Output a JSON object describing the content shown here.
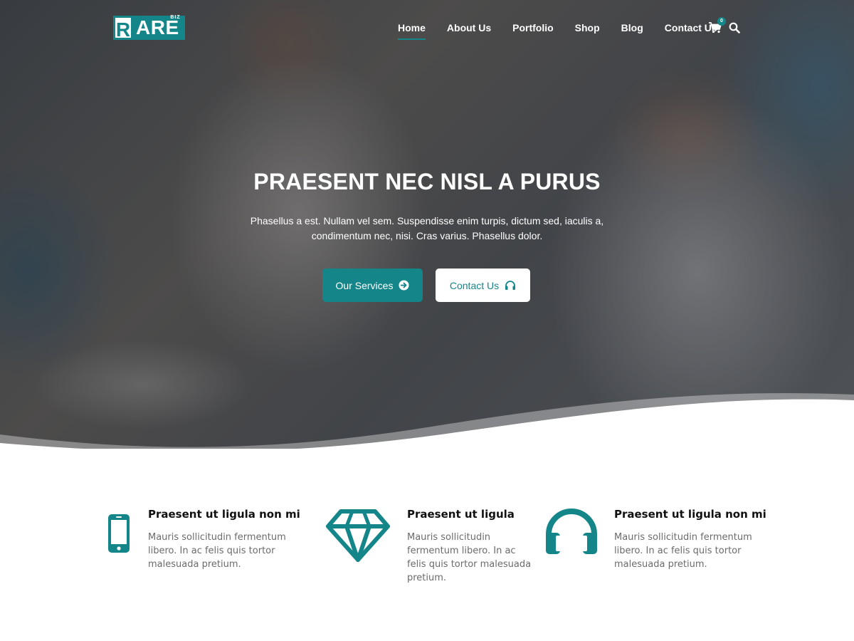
{
  "brand": {
    "logo_letter": "R",
    "logo_text": "ARE",
    "logo_tag": "BIZ",
    "accent": "#14868a"
  },
  "nav": {
    "items": [
      {
        "label": "Home",
        "active": true
      },
      {
        "label": "About Us",
        "active": false
      },
      {
        "label": "Portfolio",
        "active": false
      },
      {
        "label": "Shop",
        "active": false
      },
      {
        "label": "Blog",
        "active": false
      },
      {
        "label": "Contact Us",
        "active": false
      }
    ],
    "cart_icon": "shopping-cart-icon",
    "cart_count": "0",
    "search_icon": "search-icon"
  },
  "hero": {
    "title": "PRAESENT NEC NISL A PURUS",
    "text": "Phasellus a est. Nullam vel sem. Suspendisse enim turpis, dictum sed, iaculis a, condimentum nec, nisi. Cras varius. Phasellus dolor.",
    "primary_button": {
      "label": "Our Services",
      "icon": "arrow-circle-right-icon"
    },
    "secondary_button": {
      "label": "Contact Us",
      "icon": "headphones-icon"
    }
  },
  "features": [
    {
      "icon": "mobile-phone-icon",
      "title": "Praesent ut ligula non mi",
      "text": "Mauris sollicitudin fermentum libero. In ac felis quis tortor malesuada pretium."
    },
    {
      "icon": "diamond-icon",
      "title": "Praesent ut ligula",
      "text": "Mauris sollicitudin fermentum libero. In ac felis quis tortor malesuada pretium."
    },
    {
      "icon": "headphones-icon",
      "title": "Praesent ut ligula non mi",
      "text": "Mauris sollicitudin fermentum libero. In ac felis quis tortor malesuada pretium."
    }
  ]
}
